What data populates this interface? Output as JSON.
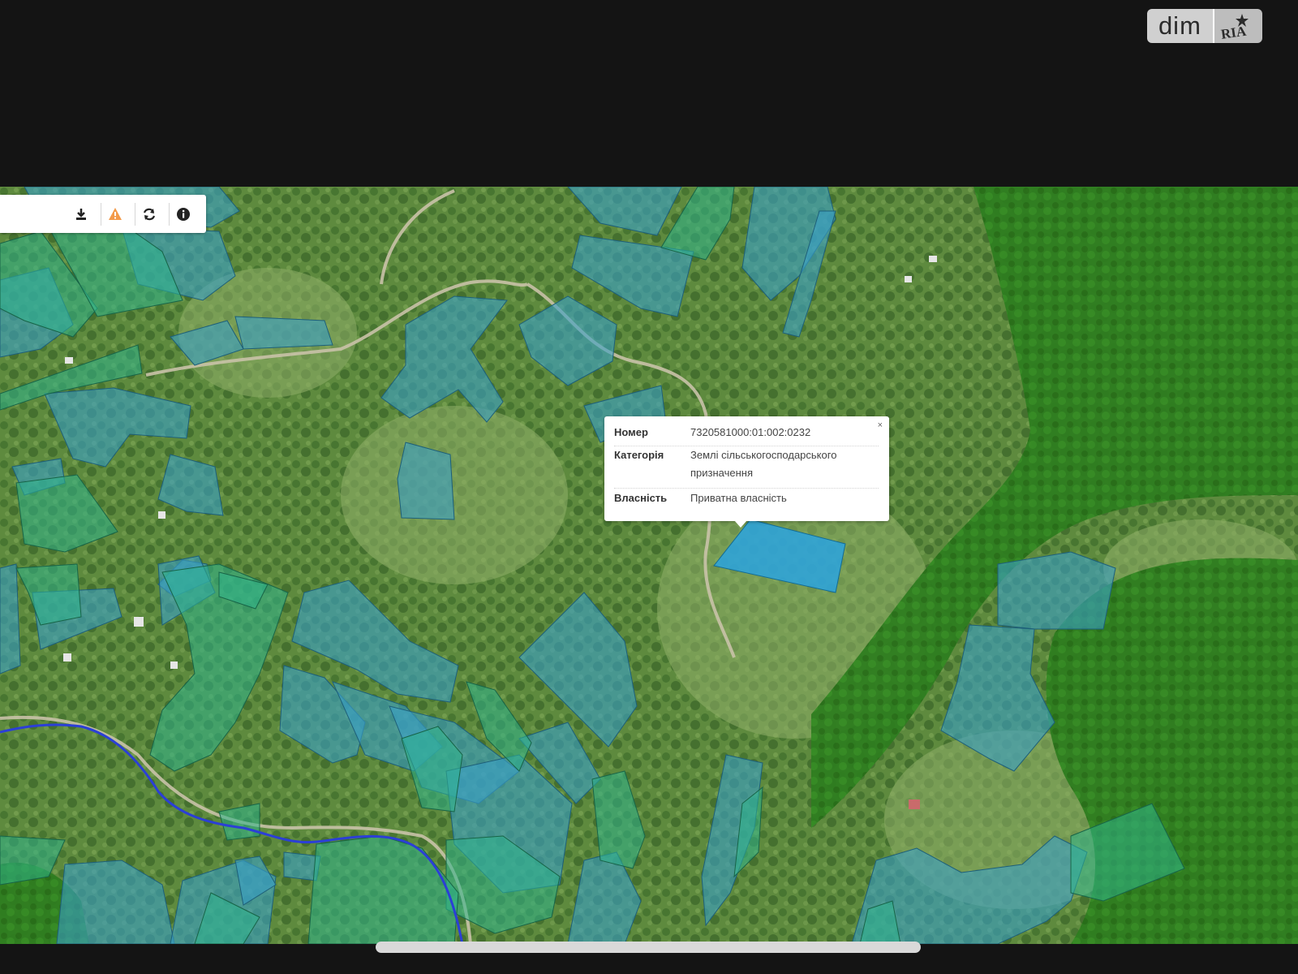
{
  "logo": {
    "text": "dim",
    "mark_text": "RIA"
  },
  "toolbar": {
    "buttons": [
      {
        "icon": "download-icon"
      },
      {
        "icon": "warning-icon"
      },
      {
        "icon": "refresh-icon"
      },
      {
        "icon": "info-icon"
      }
    ]
  },
  "popup": {
    "close": "×",
    "rows": [
      {
        "key": "Номер",
        "value": "7320581000:01:002:0232"
      },
      {
        "key": "Категорія",
        "value": "Землі сільськогосподарського призначення"
      },
      {
        "key": "Власність",
        "value": "Приватна власність"
      }
    ]
  },
  "colors": {
    "parcel_blue": "#3aa0c8",
    "parcel_green": "#2fb58c",
    "forest": "#2e8b1f",
    "river": "#2b3fd6",
    "selected_parcel": "#2aa3e0"
  }
}
